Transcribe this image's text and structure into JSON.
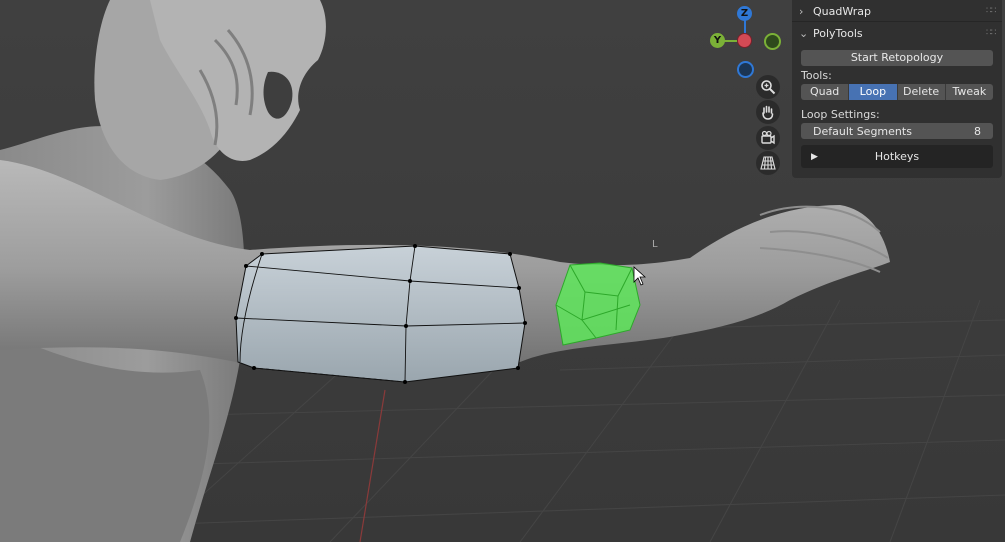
{
  "viewport": {
    "overlay_label": "L"
  },
  "gizmo": {
    "z_label": "Z",
    "y_label": "Y",
    "colors": {
      "x": "#d44a55",
      "y": "#7bb137",
      "z": "#2f78d6"
    }
  },
  "nav_buttons": [
    {
      "icon": "zoom-icon"
    },
    {
      "icon": "hand-pan-icon"
    },
    {
      "icon": "camera-icon"
    },
    {
      "icon": "grid-perspective-icon"
    }
  ],
  "npanel": {
    "quadwrap": {
      "title": "QuadWrap",
      "expanded": false
    },
    "polytools": {
      "title": "PolyTools",
      "expanded": true,
      "start_button": "Start Retopology",
      "tools_label": "Tools:",
      "tools": [
        {
          "label": "Quad",
          "active": false
        },
        {
          "label": "Loop",
          "active": true
        },
        {
          "label": "Delete",
          "active": false
        },
        {
          "label": "Tweak",
          "active": false
        }
      ],
      "loop_settings_label": "Loop Settings:",
      "segments_label": "Default Segments",
      "segments_value": "8",
      "hotkeys_label": "Hotkeys"
    }
  },
  "colors": {
    "accent": "#4772b3",
    "selection_green": "#5ee65a",
    "background": "#3d3d3d",
    "panel": "#303030"
  }
}
